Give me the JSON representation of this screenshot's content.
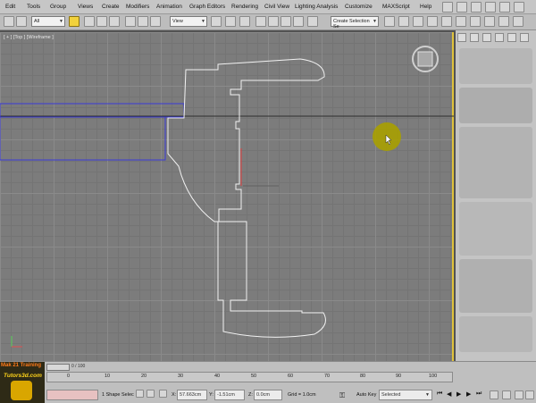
{
  "menubar": {
    "items": [
      "Edit",
      "Tools",
      "Group",
      "Views",
      "Create",
      "Modifiers",
      "Animation",
      "Graph Editors",
      "Rendering",
      "Civil View",
      "Lighting Analysis",
      "Customize",
      "MAXScript",
      "Help"
    ]
  },
  "toolbar": {
    "filter_value": "All",
    "coord_value": "View",
    "selection_set_placeholder": "Create Selection Se"
  },
  "viewport": {
    "label": "[ + ] [Top ] [Wireframe ]",
    "accent_color": "#e0c23a",
    "cursor_color": "#a8a000"
  },
  "timeline": {
    "slider_value": "0 / 100",
    "ticks": [
      "0",
      "10",
      "20",
      "30",
      "40",
      "50",
      "60",
      "70",
      "80",
      "90",
      "100"
    ]
  },
  "logo": {
    "line1": "Mak 21 Training",
    "line2": "Tutors3d.com"
  },
  "statusbar": {
    "selection_text": "1 Shape Selec",
    "x_label": "X:",
    "x_value": "57.663cm",
    "y_label": "Y:",
    "y_value": "-1.51cm",
    "z_label": "Z:",
    "z_value": "0.0cm",
    "grid_text": "Grid = 1.0cm",
    "autokey_label": "Auto Key",
    "selected_value": "Selected"
  }
}
